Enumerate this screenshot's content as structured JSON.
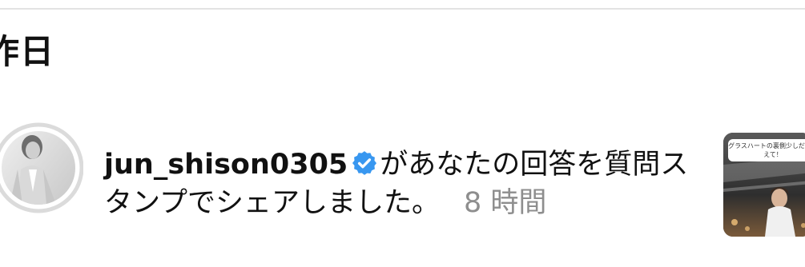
{
  "section": {
    "heading": "昨日"
  },
  "notification": {
    "username": "jun_shison0305",
    "message": "があなたの回答を質問スタンプでシェアしました。",
    "timestamp": "8 時間",
    "story_sticker_text": "グラスハートの裏側少しだけ教えて！"
  },
  "colors": {
    "verified_badge": "#3897f0",
    "timestamp": "#8e8e8e",
    "avatar_ring": "#dbdbdb"
  },
  "icons": {
    "verified": "verified-badge-icon"
  }
}
